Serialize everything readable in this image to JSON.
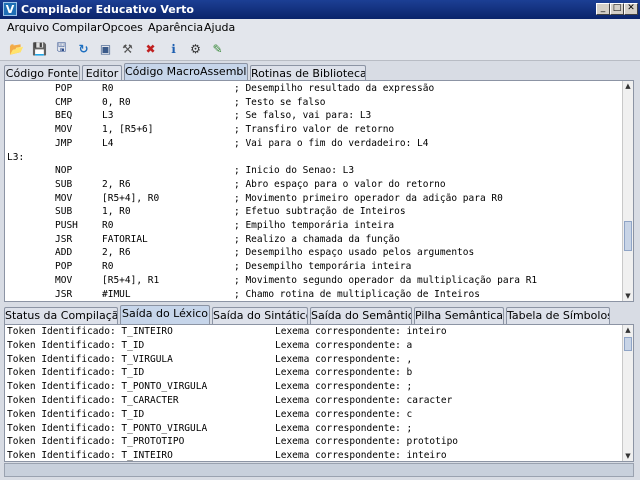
{
  "window": {
    "title": "Compilador Educativo Verto",
    "icon_letter": "V",
    "minimize": "_",
    "maximize": "□",
    "close": "✕"
  },
  "menu": [
    "Arquivo",
    "Compilar",
    "Opcoes",
    "Aparência",
    "Ajuda"
  ],
  "toolbar": {
    "icons": [
      "open-folder",
      "save",
      "save-as",
      "refresh",
      "build",
      "hammer",
      "stop",
      "info",
      "settings",
      "exit"
    ],
    "glyphs": [
      "📂",
      "💾",
      "🖫",
      "↻",
      "▣",
      "⚒",
      "✖",
      "ℹ",
      "⚙",
      "✎"
    ]
  },
  "editor_tabs": [
    {
      "label": "Código Fonte",
      "active": false
    },
    {
      "label": "Editor",
      "active": false
    },
    {
      "label": "Código MacroAssembler",
      "active": true
    },
    {
      "label": "Rotinas de Biblioteca",
      "active": false
    }
  ],
  "code_lines": [
    {
      "label": "",
      "op": "POP",
      "args": "R0",
      "comment": "; Desempilho resultado da expressão"
    },
    {
      "label": "",
      "op": "CMP",
      "args": "0, R0",
      "comment": "; Testo se falso"
    },
    {
      "label": "",
      "op": "BEQ",
      "args": "L3",
      "comment": "; Se falso, vai para: L3"
    },
    {
      "label": "",
      "op": "MOV",
      "args": "1, [R5+6]",
      "comment": "; Transfiro valor de retorno"
    },
    {
      "label": "",
      "op": "JMP",
      "args": "L4",
      "comment": "; Vai para o fim do verdadeiro: L4"
    },
    {
      "label": "L3:",
      "op": "",
      "args": "",
      "comment": ""
    },
    {
      "label": "",
      "op": "NOP",
      "args": "",
      "comment": "; Inicio do Senao: L3"
    },
    {
      "label": "",
      "op": "SUB",
      "args": "2, R6",
      "comment": "; Abro espaço para o valor do retorno"
    },
    {
      "label": "",
      "op": "MOV",
      "args": "[R5+4], R0",
      "comment": "; Movimento primeiro operador da adição para R0"
    },
    {
      "label": "",
      "op": "SUB",
      "args": "1, R0",
      "comment": "; Efetuo subtração de Inteiros"
    },
    {
      "label": "",
      "op": "PUSH",
      "args": "R0",
      "comment": "; Empilho temporária inteira"
    },
    {
      "label": "",
      "op": "JSR",
      "args": "FATORIAL",
      "comment": "; Realizo a chamada da função"
    },
    {
      "label": "",
      "op": "ADD",
      "args": "2, R6",
      "comment": "; Desempilho espaço usado pelos argumentos"
    },
    {
      "label": "",
      "op": "POP",
      "args": "R0",
      "comment": "; Desempilho temporária inteira"
    },
    {
      "label": "",
      "op": "MOV",
      "args": "[R5+4], R1",
      "comment": "; Movimento segundo operador da multiplicação para R1"
    },
    {
      "label": "",
      "op": "JSR",
      "args": "#IMUL",
      "comment": "; Chamo rotina de multiplicação de Inteiros"
    }
  ],
  "output_tabs": [
    {
      "label": "Status da Compilação",
      "active": false
    },
    {
      "label": "Saída do Léxico",
      "active": true
    },
    {
      "label": "Saída do Sintático",
      "active": false
    },
    {
      "label": "Saída do Semântico",
      "active": false
    },
    {
      "label": "Pilha Semântica",
      "active": false
    },
    {
      "label": "Tabela de Símbolos",
      "active": false
    }
  ],
  "lexer_output": [
    {
      "token": "Token Identificado: T_INTEIRO",
      "lexeme": "Lexema correspondente: inteiro"
    },
    {
      "token": "Token Identificado: T_ID",
      "lexeme": "Lexema correspondente: a"
    },
    {
      "token": "Token Identificado: T_VIRGULA",
      "lexeme": "Lexema correspondente: ,"
    },
    {
      "token": "Token Identificado: T_ID",
      "lexeme": "Lexema correspondente: b"
    },
    {
      "token": "Token Identificado: T_PONTO_VIRGULA",
      "lexeme": "Lexema correspondente: ;"
    },
    {
      "token": "Token Identificado: T_CARACTER",
      "lexeme": "Lexema correspondente: caracter"
    },
    {
      "token": "Token Identificado: T_ID",
      "lexeme": "Lexema correspondente: c"
    },
    {
      "token": "Token Identificado: T_PONTO_VIRGULA",
      "lexeme": "Lexema correspondente: ;"
    },
    {
      "token": "Token Identificado: T_PROTOTIPO",
      "lexeme": "Lexema correspondente: prototipo"
    },
    {
      "token": "Token Identificado: T_INTEIRO",
      "lexeme": "Lexema correspondente: inteiro"
    }
  ]
}
